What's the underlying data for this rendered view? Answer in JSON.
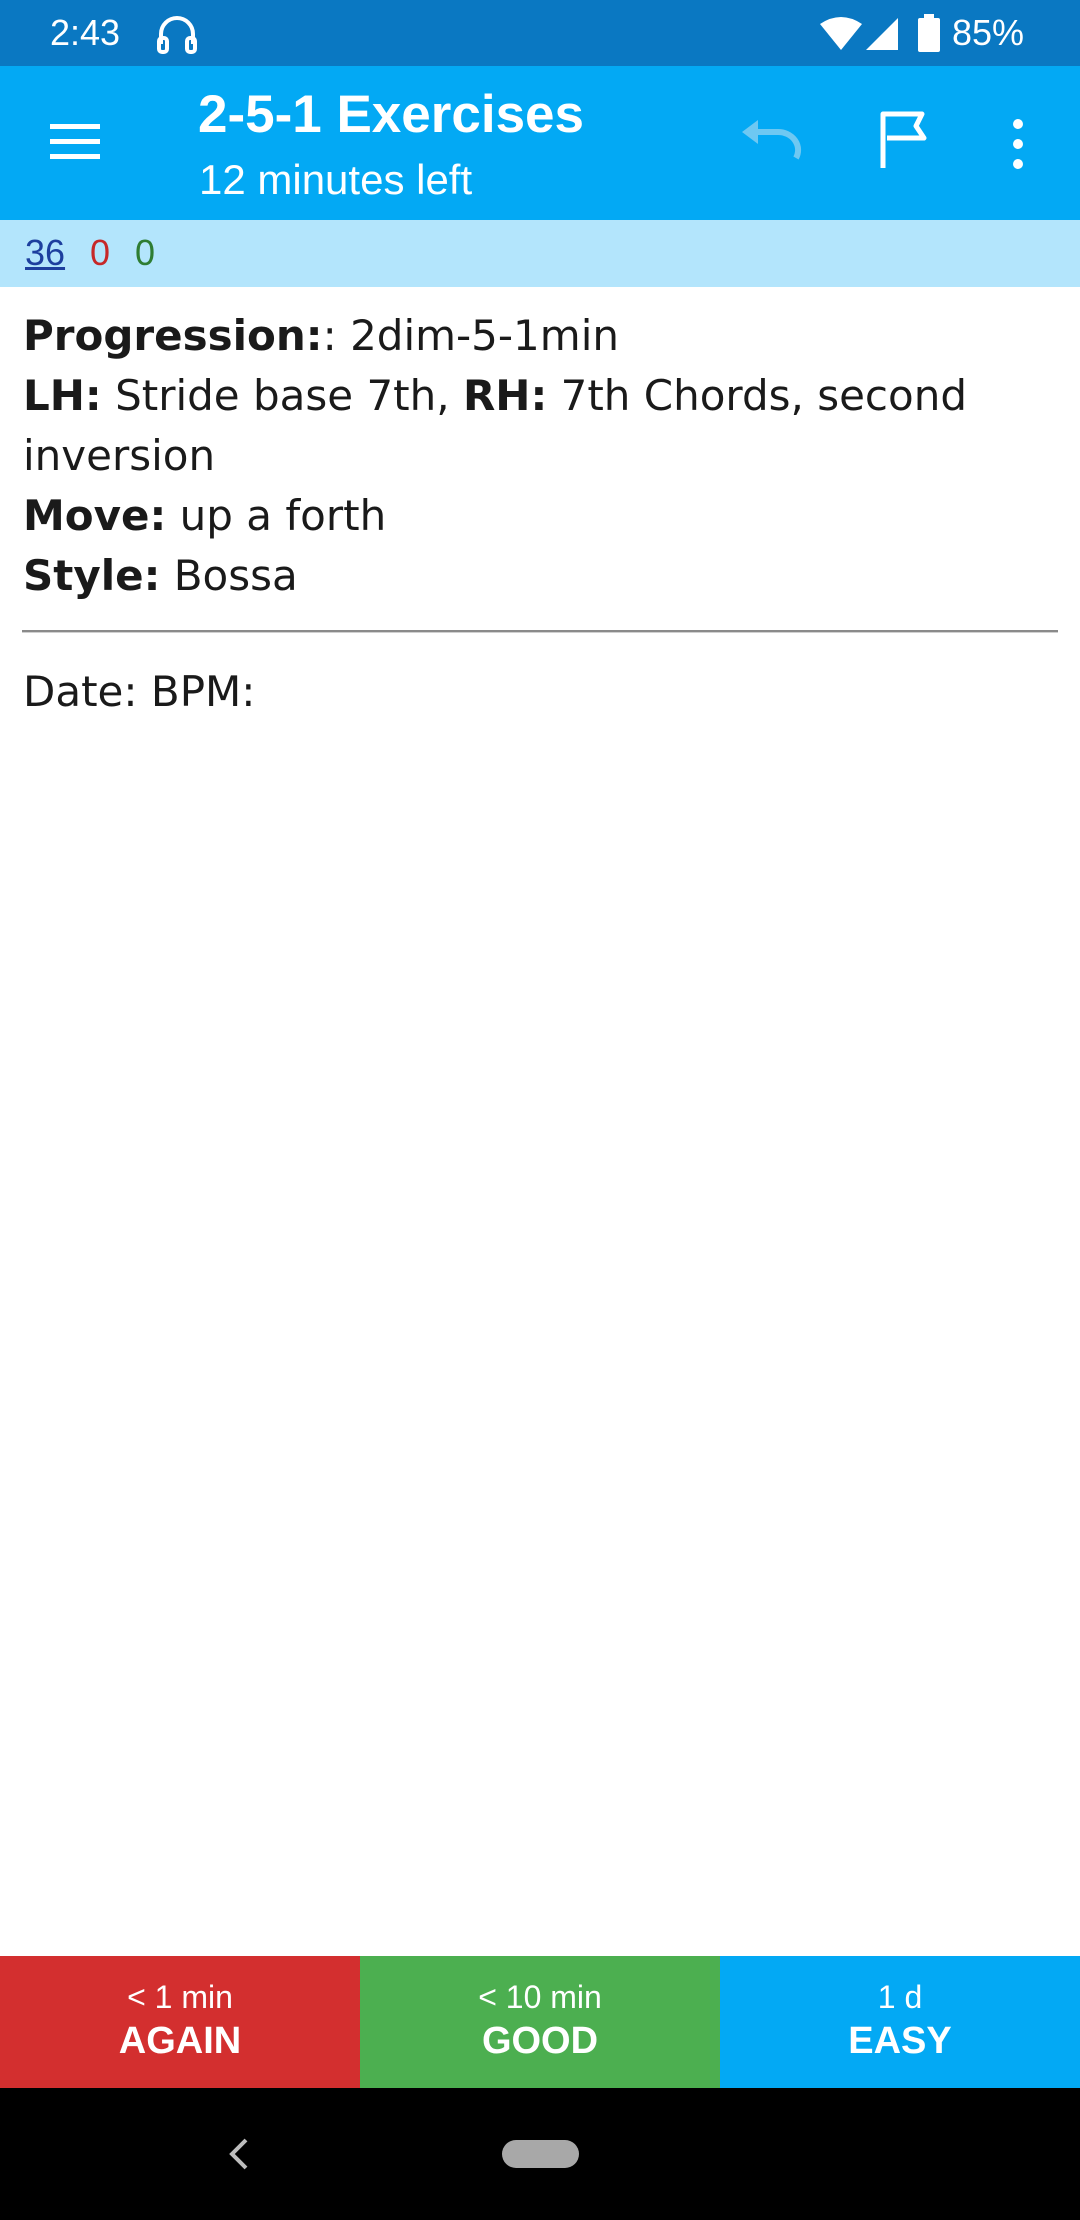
{
  "status_bar": {
    "time": "2:43",
    "battery_percent": "85%",
    "icons": [
      "headphones-icon",
      "wifi-icon",
      "cell-signal-icon",
      "battery-icon"
    ]
  },
  "app_bar": {
    "title": "2-5-1 Exercises",
    "subtitle": "12 minutes left",
    "icons": [
      "menu-icon",
      "undo-icon",
      "flag-icon",
      "more-vert-icon"
    ],
    "background_color": "#03a9f4"
  },
  "counts": {
    "new": "36",
    "learning": "0",
    "review": "0",
    "colors": {
      "new": "#1d3f9e",
      "learning": "#c62828",
      "review": "#2e7d32"
    }
  },
  "card": {
    "progression_label": "Progression:",
    "progression_value": ": 2dim-5-1min",
    "lh_label": "LH:",
    "lh_value": " Stride base 7th, ",
    "rh_label": "RH:",
    "rh_value": " 7th Chords, second inversion",
    "move_label": "Move:",
    "move_value": " up a forth",
    "style_label": "Style:",
    "style_value": " Bossa",
    "date_bpm": "Date: BPM:"
  },
  "answer_buttons": [
    {
      "interval": "< 1 min",
      "label": "AGAIN",
      "color": "#d32f2f"
    },
    {
      "interval": "< 10 min",
      "label": "GOOD",
      "color": "#4caf50"
    },
    {
      "interval": "1 d",
      "label": "EASY",
      "color": "#03a9f4"
    }
  ],
  "nav_bar": {
    "icons": [
      "back-icon",
      "home-pill"
    ]
  }
}
